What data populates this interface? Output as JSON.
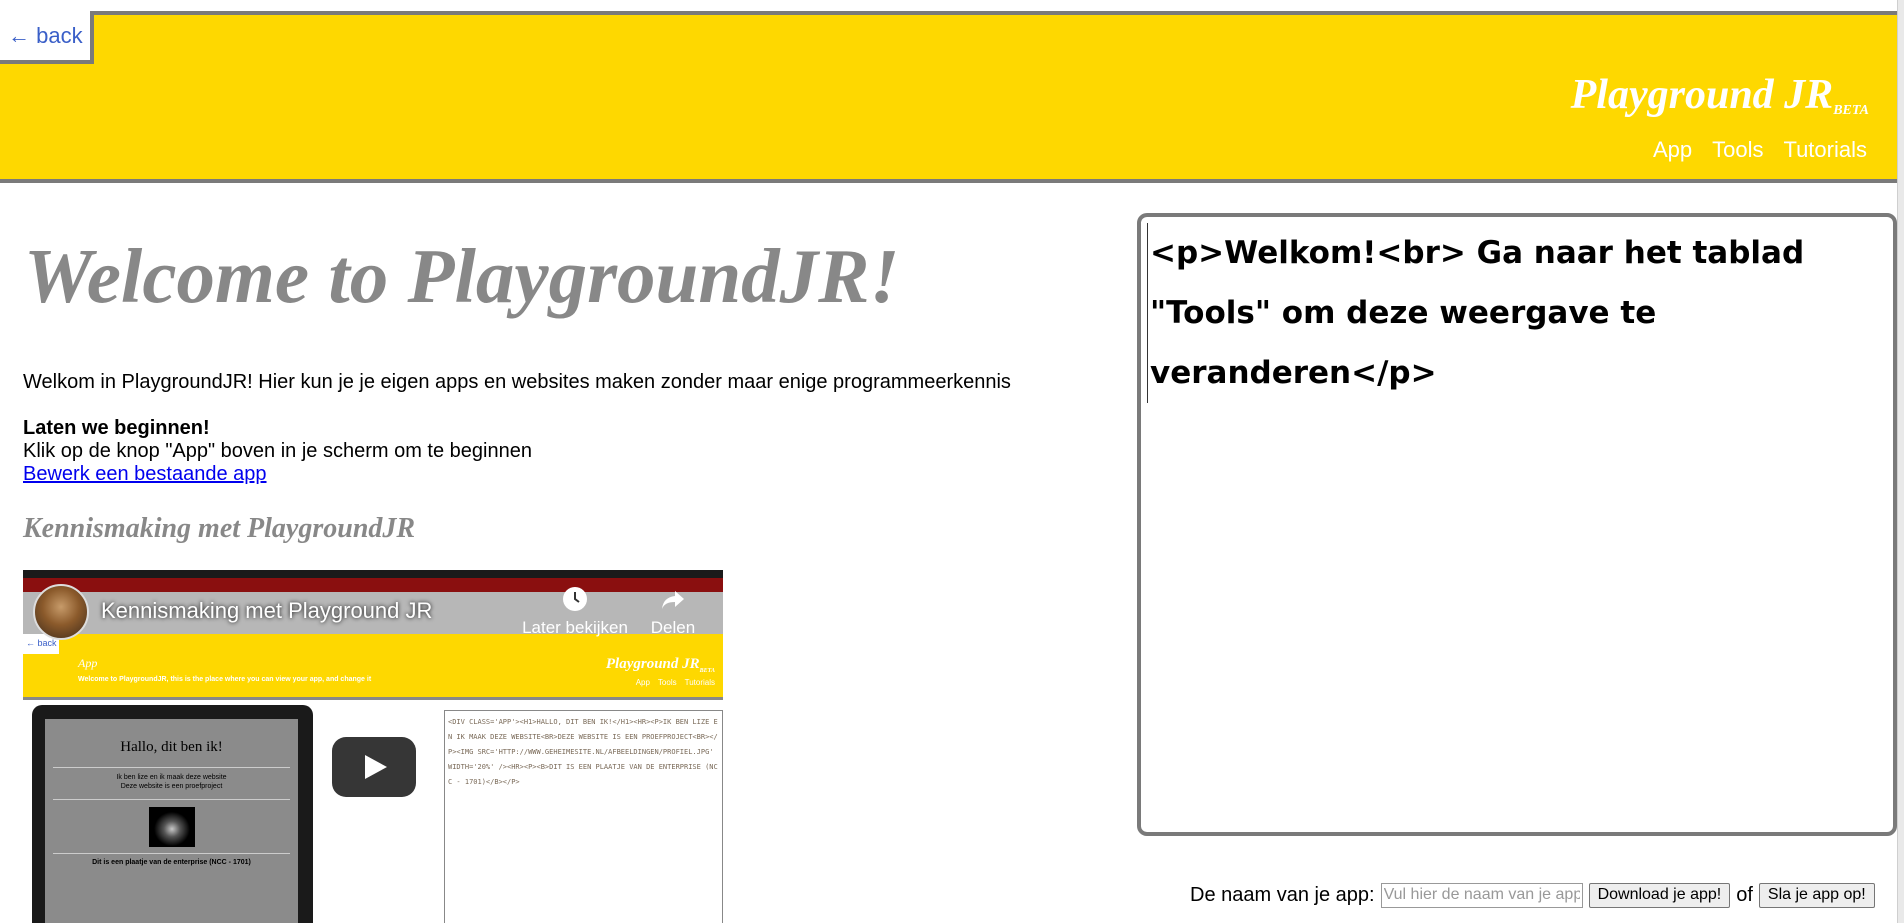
{
  "header": {
    "back_label": "← back",
    "brand": "Playground JR",
    "brand_sub": "BETA",
    "nav": [
      "App",
      "Tools",
      "Tutorials"
    ],
    "bg_color": "#fed800"
  },
  "main": {
    "title": "Welcome to PlaygroundJR!",
    "intro": "Welkom in PlaygroundJR! Hier kun je je eigen apps en websites maken zonder maar enige programmeerkennis",
    "start_heading": "Laten we beginnen!",
    "start_text": "Klik op de knop \"App\" boven in je scherm om te beginnen",
    "edit_link": "Bewerk een bestaande app",
    "video_heading": "Kennismaking met PlaygroundJR"
  },
  "video": {
    "caption": "Kennismaking met Playground JR",
    "watch_later": "Later bekijken",
    "share": "Delen",
    "inner_back": "← back",
    "inner_app": "App",
    "inner_welcome": "Welcome to PlaygroundJR, this is the place where you can view your app, and change it",
    "inner_brand": "Playground JR",
    "inner_brand_sub": "BETA",
    "inner_nav": [
      "App",
      "Tools",
      "Tutorials"
    ],
    "tablet_title": "Hallo, dit ben ik!",
    "tablet_line1": "Ik ben lize en ik maak deze website",
    "tablet_line2": "Deze website is een proefproject",
    "tablet_caption": "Dit is een plaatje van de enterprise (NCC - 1701)",
    "code": "<DIV CLASS='APP'><H1>HALLO, DIT BEN IK!</H1><HR><P>IK BEN LIZE EN IK MAAK DEZE WEBSITE<BR>DEZE WEBSITE IS EEN PROEFPROJECT<BR></P><IMG SRC='HTTP://WWW.GEHEIMESITE.NL/AFBEELDINGEN/PROFIEL.JPG' WIDTH='20%' /><HR><P><B>DIT IS EEN PLAATJE VAN DE ENTERPRISE (NCC - 1701)</B></P>"
  },
  "editor": {
    "content": "<p>Welkom!<br> Ga naar het tablad \"Tools\" om deze weergave te veranderen</p>"
  },
  "form": {
    "name_label": "De naam van je app:",
    "name_placeholder": "Vul hier de naam van je app in",
    "download_label": "Download je app!",
    "or_label": "of",
    "save_label": "Sla je app op!"
  }
}
